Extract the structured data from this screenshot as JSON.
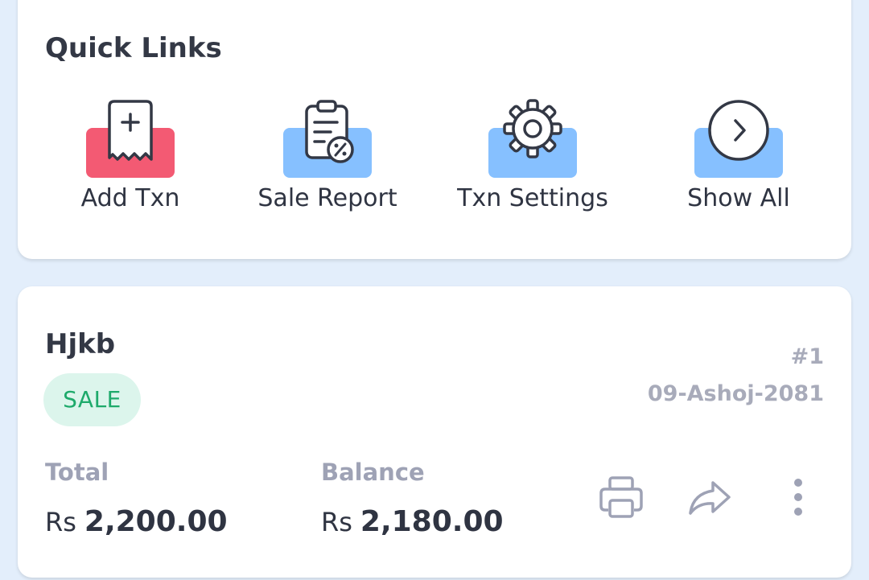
{
  "quick_links": {
    "title": "Quick Links",
    "items": [
      {
        "label": "Add Txn",
        "icon": "add-receipt-icon",
        "color": "#f35a73"
      },
      {
        "label": "Sale Report",
        "icon": "report-clipboard-icon",
        "color": "#86c0ff"
      },
      {
        "label": "Txn Settings",
        "icon": "gear-icon",
        "color": "#86c0ff"
      },
      {
        "label": "Show All",
        "icon": "chevron-right-circle-icon",
        "color": "#86c0ff"
      }
    ]
  },
  "transaction": {
    "party_name": "Hjkb",
    "type_badge": "SALE",
    "number": "#1",
    "date": "09-Ashoj-2081",
    "total_label": "Total",
    "currency": "Rs",
    "total_value": "2,200.00",
    "balance_label": "Balance",
    "balance_value": "2,180.00",
    "actions": [
      "print-icon",
      "share-icon",
      "more-vertical-icon"
    ]
  },
  "colors": {
    "page_background": "#e3eefb",
    "card": "#ffffff",
    "sale_badge_bg": "#dcf5ec",
    "sale_badge_text": "#1eaa6b",
    "muted_text": "#a8abba"
  }
}
